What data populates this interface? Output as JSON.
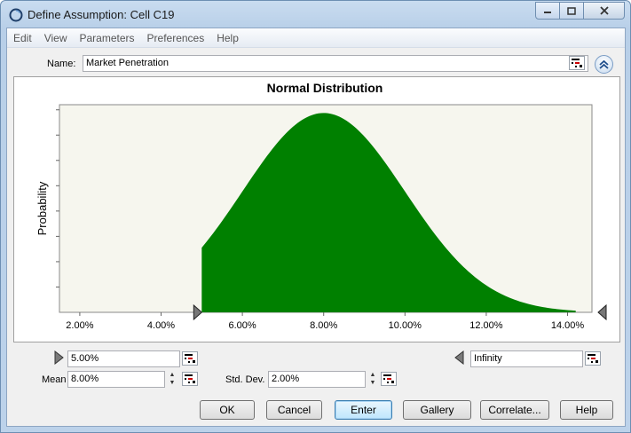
{
  "window": {
    "title": "Define Assumption: Cell C19"
  },
  "menu": [
    {
      "label": "Edit"
    },
    {
      "label": "View"
    },
    {
      "label": "Parameters"
    },
    {
      "label": "Preferences"
    },
    {
      "label": "Help"
    }
  ],
  "name_field": {
    "label": "Name:",
    "value": "Market Penetration"
  },
  "chart_data": {
    "type": "area",
    "title": "Normal Distribution",
    "ylabel": "Probability",
    "xlabel": "",
    "x_tick_labels": [
      "2.00%",
      "4.00%",
      "6.00%",
      "8.00%",
      "10.00%",
      "12.00%",
      "14.00%"
    ],
    "x_ticks": [
      2,
      4,
      6,
      8,
      10,
      12,
      14
    ],
    "xlim": [
      1.5,
      14.6
    ],
    "distribution": {
      "mean": 8.0,
      "std_dev": 2.0
    },
    "truncation": {
      "min": 5.0,
      "max": 14.2
    },
    "fill_color": "#008000",
    "plot_background": "#f6f6ee",
    "grid": false,
    "y_tick_count": 8
  },
  "bounds": {
    "min_value": "5.00%",
    "max_value": "Infinity"
  },
  "parameters": {
    "mean_label": "Mean",
    "mean_value": "8.00%",
    "std_label": "Std. Dev.",
    "std_value": "2.00%"
  },
  "buttons": {
    "ok": "OK",
    "cancel": "Cancel",
    "enter": "Enter",
    "gallery": "Gallery",
    "correlate": "Correlate...",
    "help": "Help"
  },
  "colors": {
    "accent": "#3c7fb1",
    "curve": "#008000"
  }
}
